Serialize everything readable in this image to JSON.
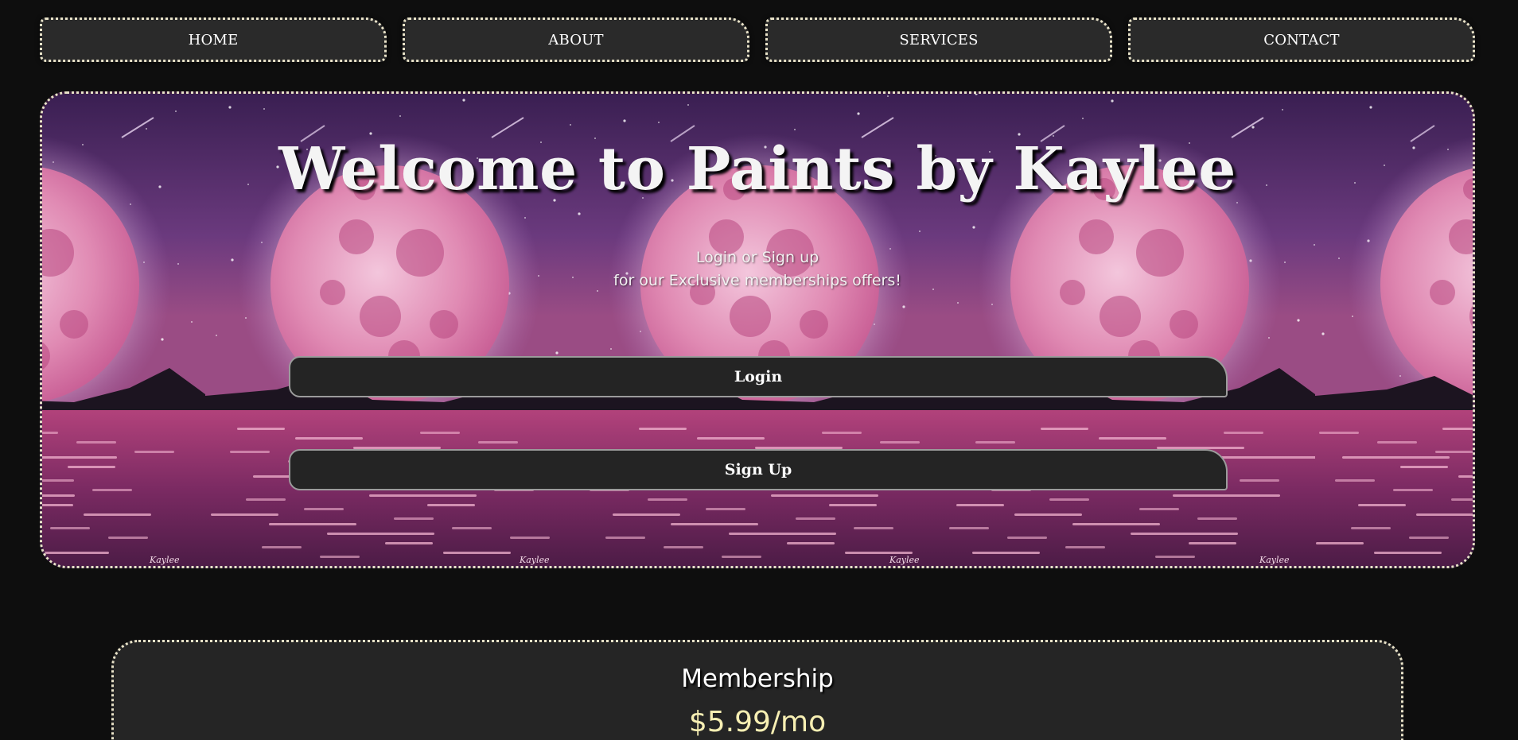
{
  "nav": {
    "items": [
      {
        "label": "HOME"
      },
      {
        "label": "ABOUT"
      },
      {
        "label": "SERVICES"
      },
      {
        "label": "CONTACT"
      }
    ]
  },
  "hero": {
    "title": "Welcome to Paints by Kaylee",
    "subtitle_line1": "Login or Sign up",
    "subtitle_line2": "for our Exclusive memberships offers!",
    "login_label": "Login",
    "signup_label": "Sign Up",
    "background_image": "pink-moon-over-water-painting",
    "signature": "Kaylee"
  },
  "membership": {
    "title": "Membership",
    "price": "$5.99/mo"
  },
  "colors": {
    "page_background": "#0e0e0e",
    "button_background": "#2a2a2a",
    "dotted_border": "#e8e2c8",
    "price_text": "#f7efb3"
  }
}
